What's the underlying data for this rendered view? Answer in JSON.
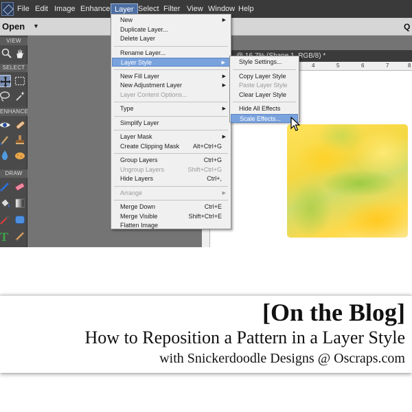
{
  "menubar": {
    "items": [
      "File",
      "Edit",
      "Image",
      "Enhance",
      "Layer",
      "Select",
      "Filter",
      "View",
      "Window",
      "Help"
    ],
    "active": "Layer"
  },
  "optionsbar": {
    "open_label": "Open",
    "right_fragment": "Q"
  },
  "toolpanel": {
    "sections": [
      "VIEW",
      "SELECT",
      "ENHANCE",
      "DRAW"
    ],
    "icons": [
      "zoom-icon",
      "hand-icon",
      "move-icon",
      "marquee-icon",
      "lasso-icon",
      "magic-wand-icon",
      "eye-icon",
      "brush-heal-icon",
      "brush-icon",
      "clone-stamp-icon",
      "blur-drop-icon",
      "sponge-icon",
      "pencil-icon",
      "eraser-icon",
      "paint-bucket-icon",
      "gradient-icon",
      "eyedropper-icon",
      "shape-icon",
      "type-icon",
      "pencil2-icon"
    ]
  },
  "document": {
    "title_fragment": "@ 16.7% (Shape 1, RGB/8) *",
    "ruler_numbers": [
      "4",
      "5",
      "6",
      "7",
      "8"
    ]
  },
  "layer_menu": {
    "items": [
      {
        "label": "New",
        "submenu": true
      },
      {
        "label": "Duplicate Layer..."
      },
      {
        "label": "Delete Layer"
      },
      {
        "sep": true
      },
      {
        "label": "Rename Layer..."
      },
      {
        "label": "Layer Style",
        "submenu": true,
        "highlight": true
      },
      {
        "sep": true
      },
      {
        "label": "New Fill Layer",
        "submenu": true
      },
      {
        "label": "New Adjustment Layer",
        "submenu": true
      },
      {
        "label": "Layer Content Options...",
        "disabled": true
      },
      {
        "sep": true
      },
      {
        "label": "Type",
        "submenu": true
      },
      {
        "sep": true
      },
      {
        "label": "Simplify Layer"
      },
      {
        "sep": true
      },
      {
        "label": "Layer Mask",
        "submenu": true
      },
      {
        "label": "Create Clipping Mask",
        "shortcut": "Alt+Ctrl+G"
      },
      {
        "sep": true
      },
      {
        "label": "Group Layers",
        "shortcut": "Ctrl+G"
      },
      {
        "label": "Ungroup Layers",
        "shortcut": "Shift+Ctrl+G",
        "disabled": true
      },
      {
        "label": "Hide Layers",
        "shortcut": "Ctrl+,"
      },
      {
        "sep": true
      },
      {
        "label": "Arrange",
        "submenu": true,
        "disabled": true
      },
      {
        "sep": true
      },
      {
        "label": "Merge Down",
        "shortcut": "Ctrl+E"
      },
      {
        "label": "Merge Visible",
        "shortcut": "Shift+Ctrl+E"
      },
      {
        "label": "Flatten Image"
      }
    ]
  },
  "layer_style_submenu": {
    "items": [
      {
        "label": "Style Settings..."
      },
      {
        "sep": true
      },
      {
        "label": "Copy Layer Style"
      },
      {
        "label": "Paste Layer Style",
        "disabled": true
      },
      {
        "label": "Clear Layer Style"
      },
      {
        "sep": true
      },
      {
        "label": "Hide All Effects"
      },
      {
        "label": "Scale Effects...",
        "highlight": true
      }
    ]
  },
  "banner": {
    "line1": "[On the Blog]",
    "line2": "How to Reposition a Pattern in a Layer Style",
    "line3": "with Snickerdoodle Designs @ Oscraps.com"
  }
}
